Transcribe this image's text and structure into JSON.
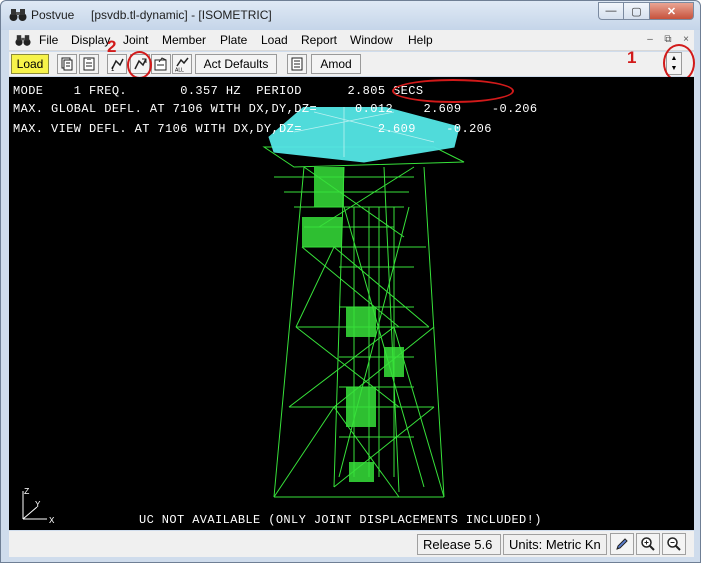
{
  "window": {
    "app_name": "Postvue",
    "document": "[psvdb.tl-dynamic] - [ISOMETRIC]",
    "controls": {
      "minimize": "—",
      "maximize": "▢",
      "close": "✕"
    }
  },
  "menu": {
    "items": [
      "File",
      "Display",
      "Joint",
      "Member",
      "Plate",
      "Load",
      "Report",
      "Window",
      "Help"
    ],
    "mdi": {
      "minimize": "–",
      "restore": "⧉",
      "close": "×"
    }
  },
  "toolbar": {
    "load_label": "Load",
    "act_defaults_label": "Act Defaults",
    "amod_label": "Amod",
    "spin_up": "▲",
    "spin_down": "▼"
  },
  "annotations": {
    "marker_1": "1",
    "marker_2": "2"
  },
  "viewport": {
    "line1": "MODE    1 FREQ.       0.357 HZ  PERIOD      2.805 SECS",
    "line2": "MAX. GLOBAL DEFL. AT 7106 WITH DX,DY,DZ=     0.012    2.609    -0.206",
    "line3": "MAX. VIEW DEFL. AT 7106 WITH DX,DY,DZ=          2.609    -0.206",
    "footer": "UC NOT AVAILABLE (ONLY JOINT DISPLACEMENTS INCLUDED!)",
    "axis": {
      "z": "Z",
      "y": "Y",
      "x": "X"
    }
  },
  "colors": {
    "model_green": "#37e13a",
    "model_cyan": "#55e7e6",
    "annotation_red": "#d21a1a",
    "load_yellow": "#f7f34a"
  },
  "statusbar": {
    "release": "Release 5.6",
    "units": "Units: Metric Kn"
  }
}
